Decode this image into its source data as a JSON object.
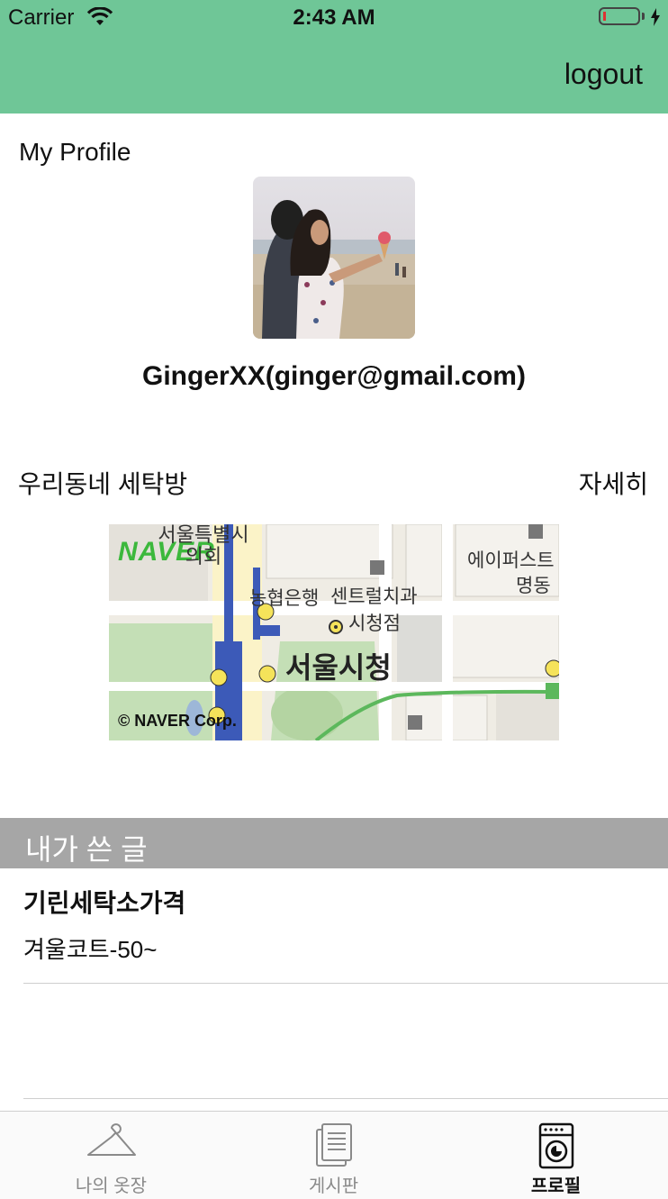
{
  "status_bar": {
    "carrier": "Carrier",
    "time": "2:43 AM"
  },
  "header": {
    "logout_label": "logout",
    "background_color": "#6fc697"
  },
  "profile": {
    "section_title": "My Profile",
    "username": "GingerXX(ginger@gmail.com)"
  },
  "laundry": {
    "section_title": "우리동네 세탁방",
    "detail_label": "자세히",
    "map": {
      "logo": "NAVER",
      "copyright": "© NAVER Corp.",
      "labels": {
        "council": "서울특별시 의회",
        "bank": "농협은행",
        "dental": "센트럴치과",
        "branch": "시청점",
        "city_hall": "서울시청",
        "apartment": "에이퍼스트",
        "apartment2": "명동"
      }
    }
  },
  "my_posts": {
    "section_title": "내가 쓴 글",
    "items": [
      {
        "title": "기린세탁소가격",
        "subtitle": "겨울코트-50~"
      }
    ]
  },
  "tabbar": {
    "tabs": [
      {
        "label": "나의 옷장",
        "icon": "hanger-icon",
        "active": false
      },
      {
        "label": "게시판",
        "icon": "document-icon",
        "active": false
      },
      {
        "label": "프로필",
        "icon": "washing-machine-icon",
        "active": true
      }
    ],
    "active_color": "#111111",
    "inactive_color": "#8a8a8a"
  }
}
